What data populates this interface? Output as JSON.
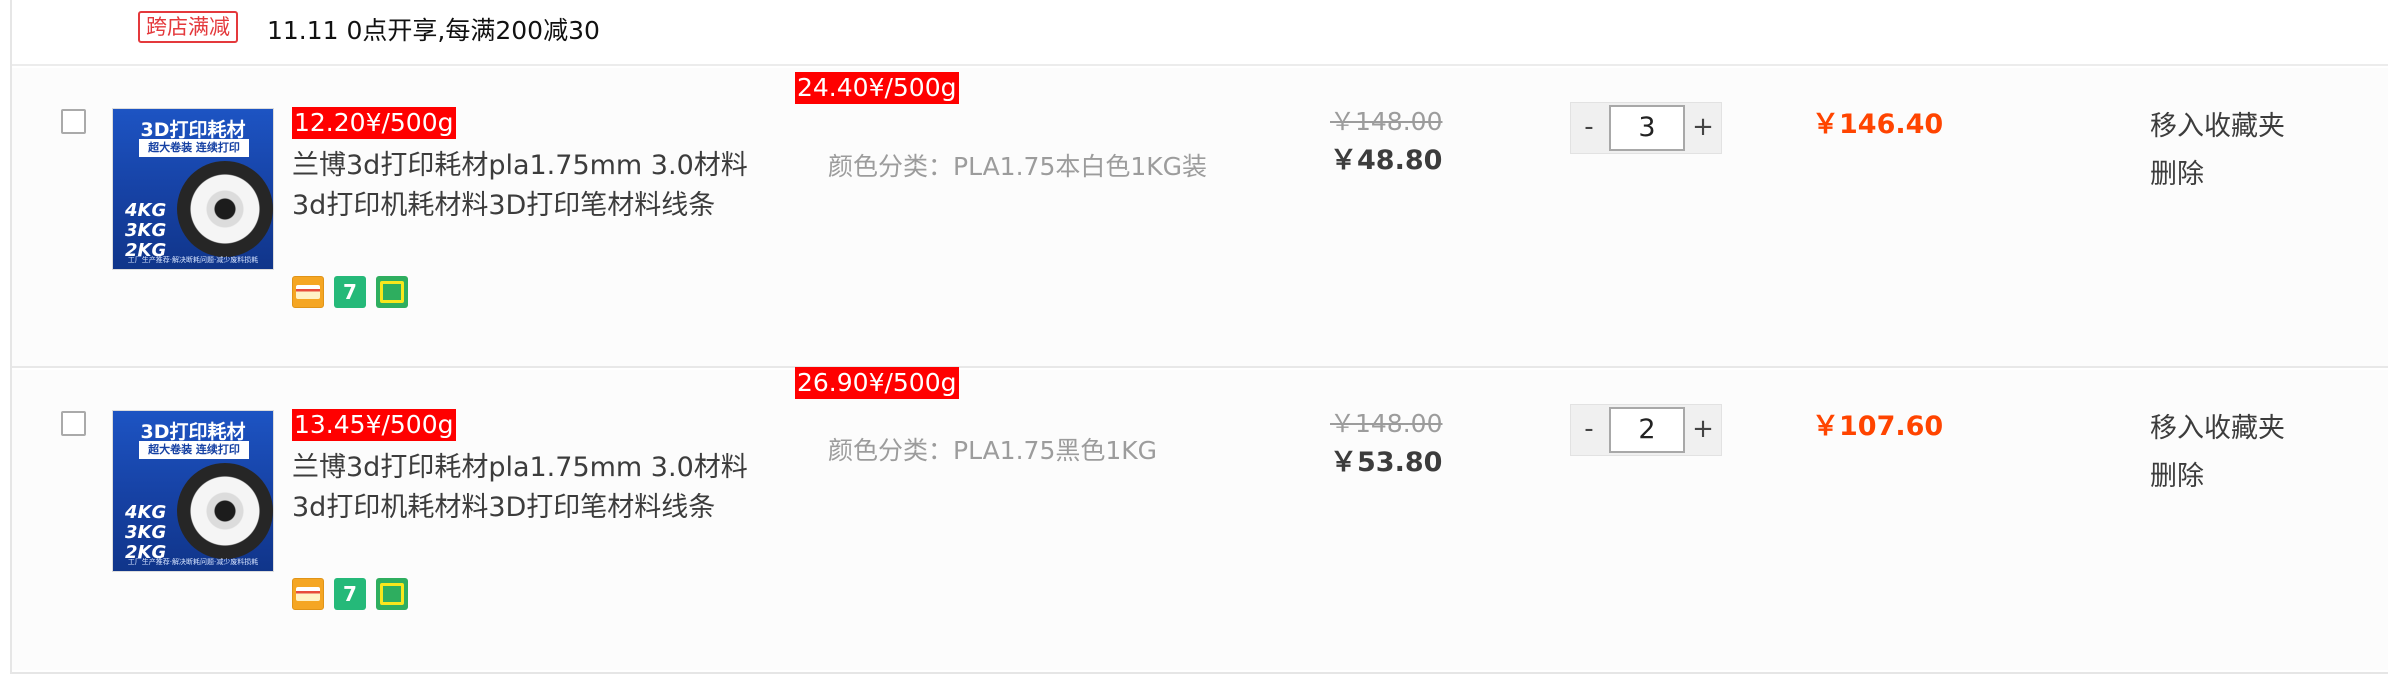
{
  "promo": {
    "tag": "跨店满减",
    "text": "11.11 0点开享,每满200减30"
  },
  "items": [
    {
      "unit_price_left": "12.20¥/500g",
      "unit_price_mid": "24.40¥/500g",
      "thumb_title": "3D打印耗材",
      "thumb_sub": "超大卷装 连续打印",
      "thumb_kg": "4KG\n3KG\n2KG",
      "thumb_foot": "工厂生产推荐·解决断耗问题·减少废料损耗",
      "title": "兰博3d打印耗材pla1.75mm 3.0材料3d打印机耗材料3D打印笔材料线条",
      "badge_seven": "7",
      "sku": "颜色分类：PLA1.75本白色1KG装",
      "orig_price": "￥148.00",
      "now_price": "￥48.80",
      "qty_minus": "-",
      "qty_value": "3",
      "qty_plus": "+",
      "subtotal": "￥146.40",
      "op_fav": "移入收藏夹",
      "op_del": "删除"
    },
    {
      "unit_price_left": "13.45¥/500g",
      "unit_price_mid": "26.90¥/500g",
      "thumb_title": "3D打印耗材",
      "thumb_sub": "超大卷装 连续打印",
      "thumb_kg": "4KG\n3KG\n2KG",
      "thumb_foot": "工厂生产推荐·解决断耗问题·减少废料损耗",
      "title": "兰博3d打印耗材pla1.75mm 3.0材料3d打印机耗材料3D打印笔材料线条",
      "badge_seven": "7",
      "sku": "颜色分类：PLA1.75黑色1KG",
      "orig_price": "￥148.00",
      "now_price": "￥53.80",
      "qty_minus": "-",
      "qty_value": "2",
      "qty_plus": "+",
      "subtotal": "￥107.60",
      "op_fav": "移入收藏夹",
      "op_del": "删除"
    }
  ],
  "colors": {
    "accent_red": "#ff0000",
    "price_orange": "#ff4400",
    "tag_red": "#e4393c"
  },
  "icons": [
    "card-payment-icon",
    "seven-day-return-icon",
    "gift-icon"
  ]
}
